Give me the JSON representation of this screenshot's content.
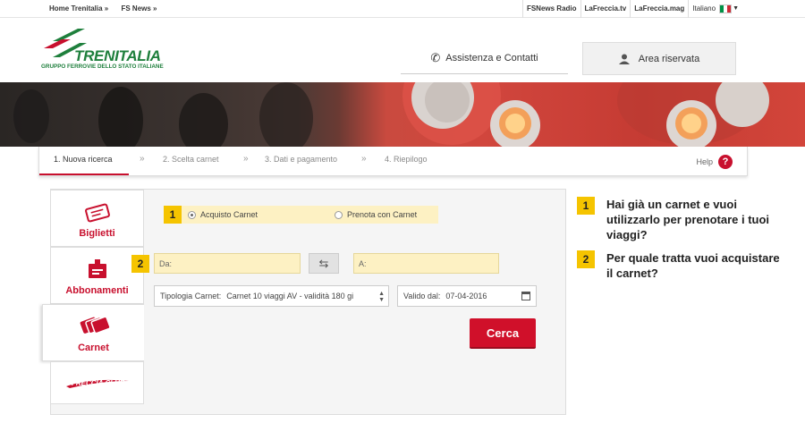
{
  "topbar": {
    "left_links": [
      "Home Trenitalia »",
      "FS News »"
    ],
    "right_links": [
      "FSNews Radio",
      "LaFreccia.tv",
      "LaFreccia.mag"
    ],
    "language": "Italiano"
  },
  "header": {
    "logo_text": "TRENITALIA",
    "logo_sub": "GRUPPO FERROVIE DELLO STATO ITALIANE",
    "assist_label": "Assistenza e Contatti",
    "area_label": "Area riservata"
  },
  "steps": {
    "items": [
      "1. Nuova ricerca",
      "2. Scelta carnet",
      "3. Dati e pagamento",
      "4. Riepilogo"
    ],
    "separator": "»",
    "help_label": "Help"
  },
  "sidebar": {
    "items": [
      {
        "label": "Biglietti",
        "icon": "ticket-icon"
      },
      {
        "label": "Abbonamenti",
        "icon": "badge-icon"
      },
      {
        "label": "Carnet",
        "icon": "carnet-icon"
      },
      {
        "label": "FRECCIA CLUB",
        "icon": "frecciaclub-logo"
      }
    ]
  },
  "form": {
    "badge1": "1",
    "option_purchase": "Acquisto Carnet",
    "option_book": "Prenota con Carnet",
    "badge2": "2",
    "from_label": "Da:",
    "to_label": "A:",
    "carnet_type_label": "Tipologia Carnet:",
    "carnet_type_value": "Carnet 10 viaggi AV - validità 180 gi",
    "valid_from_label": "Valido dal:",
    "valid_from_value": "07-04-2016",
    "search_button": "Cerca"
  },
  "instructions": [
    {
      "num": "1",
      "text": "Hai già un carnet e vuoi utilizzarlo per prenotare i tuoi viaggi?"
    },
    {
      "num": "2",
      "text": "Per quale tratta vuoi acquistare il carnet?"
    }
  ],
  "colors": {
    "brand_red": "#c8102e",
    "brand_green": "#1e7f3c",
    "highlight_yellow": "#f5c400"
  }
}
